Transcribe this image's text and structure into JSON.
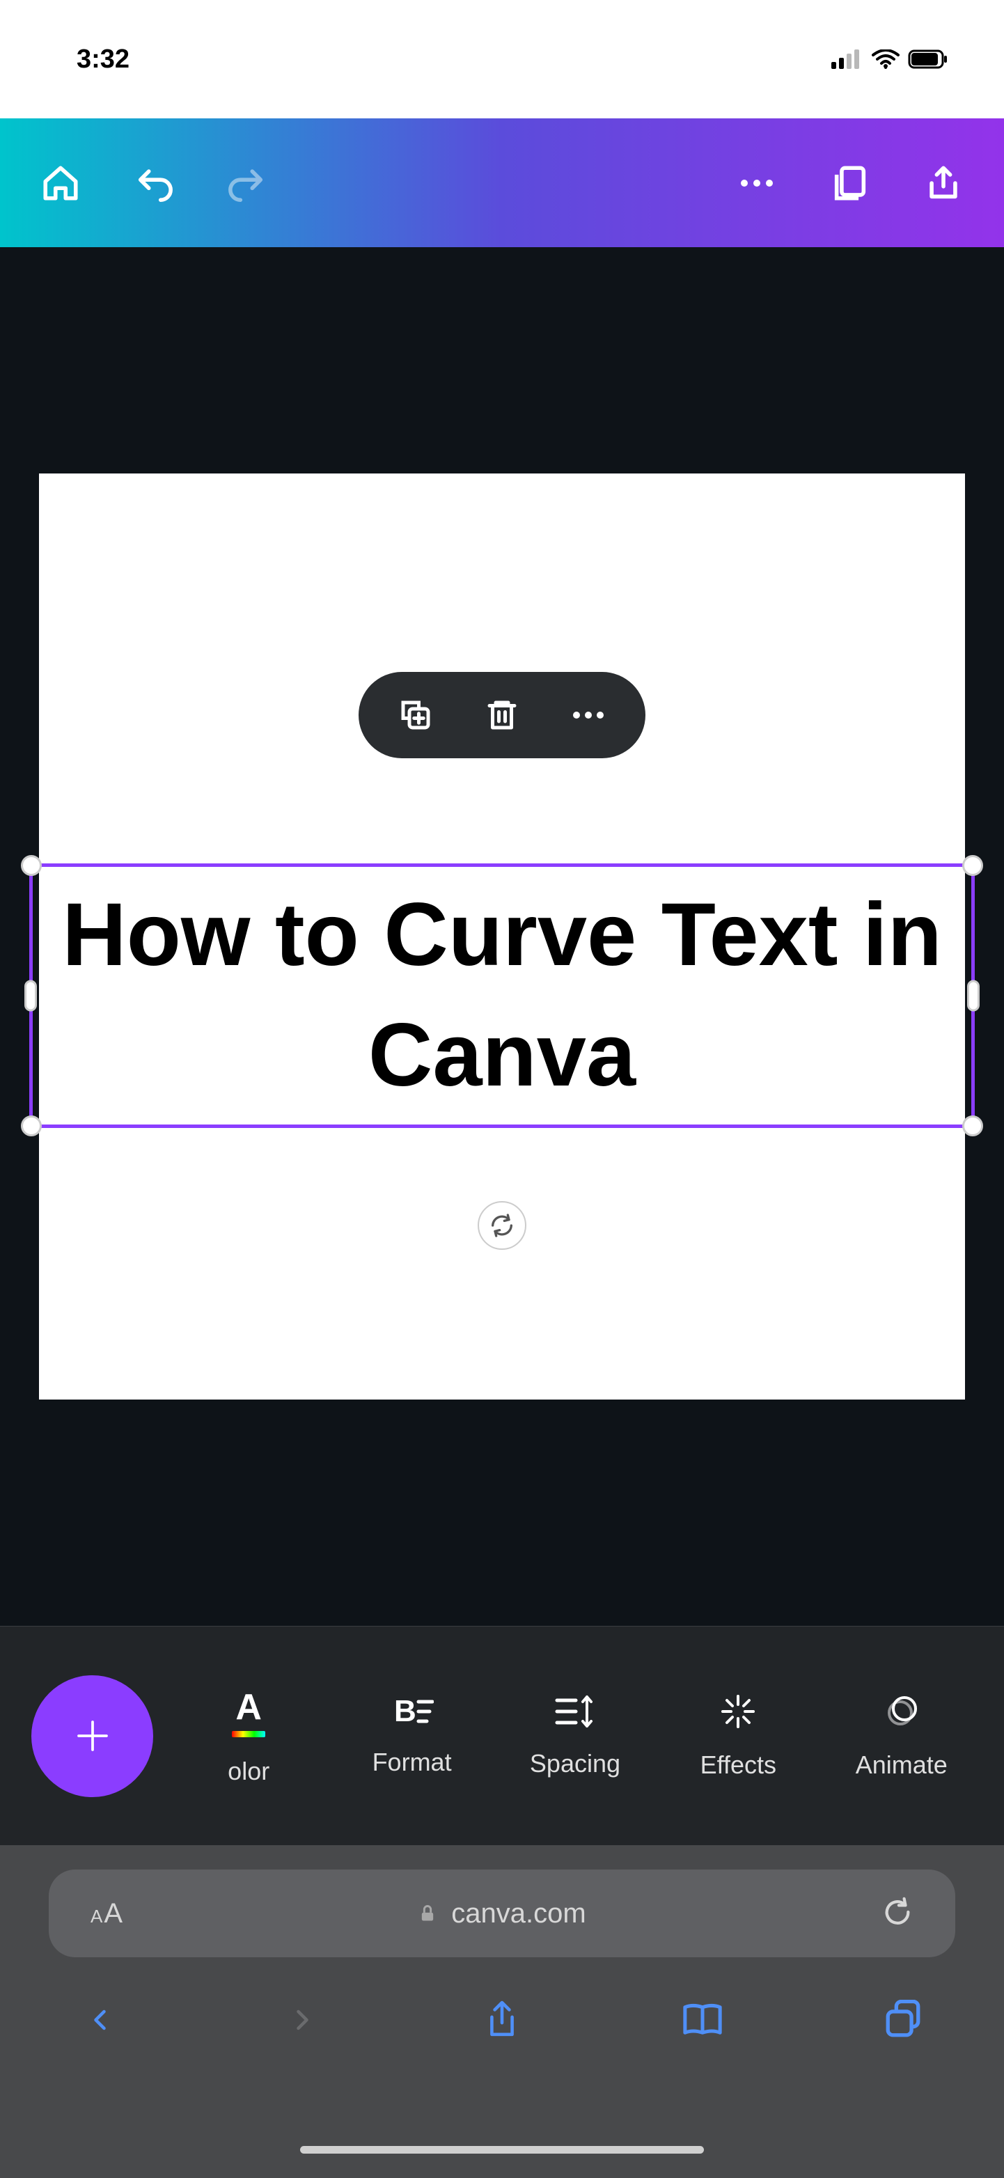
{
  "statusBar": {
    "time": "3:32"
  },
  "canvas": {
    "textContent": "How to Curve Text in Canva"
  },
  "toolbar": {
    "items": {
      "color": "olor",
      "format": "Format",
      "spacing": "Spacing",
      "effects": "Effects",
      "animate": "Animate"
    }
  },
  "browser": {
    "url": "canva.com",
    "sizeToggle": "AA"
  }
}
